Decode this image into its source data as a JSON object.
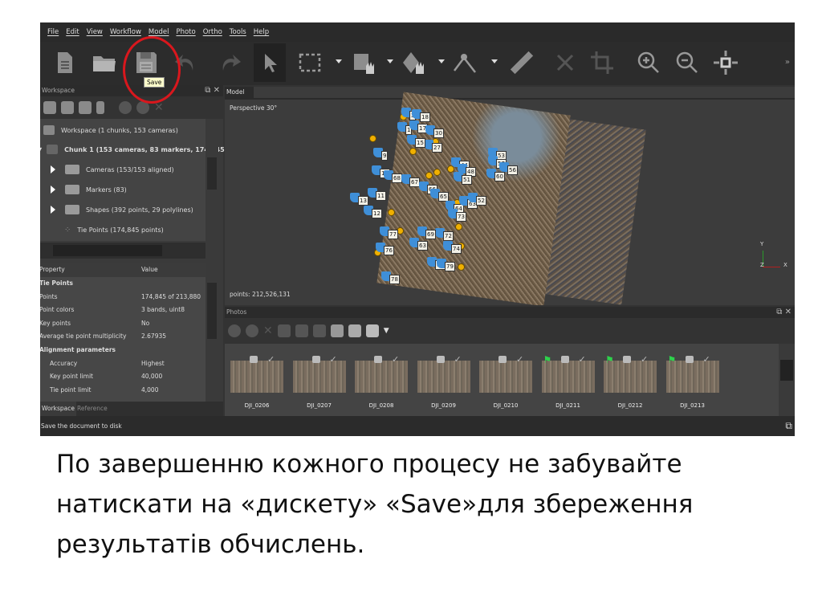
{
  "menu": [
    "File",
    "Edit",
    "View",
    "Workflow",
    "Model",
    "Photo",
    "Ortho",
    "Tools",
    "Help"
  ],
  "tooltip": "Save",
  "workspace": {
    "title": "Workspace",
    "root": "Workspace (1 chunks, 153 cameras)",
    "chunk": "Chunk 1 (153 cameras, 83 markers, 174,845",
    "cameras": "Cameras (153/153 aligned)",
    "markers": "Markers (83)",
    "shapes": "Shapes (392 points, 29 polylines)",
    "tiepoints": "Tie Points (174,845 points)"
  },
  "properties": {
    "header_property": "Property",
    "header_value": "Value",
    "rows": [
      {
        "k": "Tie Points",
        "v": "",
        "bold": true
      },
      {
        "k": "Points",
        "v": "174,845 of 213,880"
      },
      {
        "k": "Point colors",
        "v": "3 bands, uint8"
      },
      {
        "k": "Key points",
        "v": "No"
      },
      {
        "k": "Average tie point multiplicity",
        "v": "2.67935"
      },
      {
        "k": "Alignment parameters",
        "v": "",
        "bold": true
      },
      {
        "k": "  Accuracy",
        "v": "Highest"
      },
      {
        "k": "  Key point limit",
        "v": "40,000"
      },
      {
        "k": "  Tie point limit",
        "v": "4,000"
      }
    ]
  },
  "tabs": {
    "workspace": "Workspace",
    "reference": "Reference"
  },
  "status": "Save the document to disk",
  "model": {
    "title": "Model",
    "view": "Perspective 30°",
    "points": "points: 212,526,131",
    "axis_y": "Y",
    "axis_z": "Z",
    "axis_x": "X",
    "markers": [
      "3",
      "1",
      "18",
      "17",
      "30",
      "27",
      "15",
      "9",
      "46",
      "44",
      "48",
      "51",
      "53",
      "57",
      "56",
      "60",
      "10",
      "68",
      "67",
      "66",
      "65",
      "11",
      "13",
      "12",
      "64",
      "63",
      "52",
      "73",
      "77",
      "72",
      "69",
      "74",
      "76",
      "63",
      "80",
      "79",
      "78"
    ]
  },
  "photos": {
    "title": "Photos",
    "items": [
      {
        "name": "DJI_0206",
        "flag": false
      },
      {
        "name": "DJI_0207",
        "flag": false
      },
      {
        "name": "DJI_0208",
        "flag": false
      },
      {
        "name": "DJI_0209",
        "flag": false
      },
      {
        "name": "DJI_0210",
        "flag": false
      },
      {
        "name": "DJI_0211",
        "flag": true
      },
      {
        "name": "DJI_0212",
        "flag": true
      },
      {
        "name": "DJI_0213",
        "flag": true
      }
    ]
  },
  "caption": "По завершенню кожного процесу не забувайте натискати на «дискету» «Save»для збереження результатів обчислень."
}
